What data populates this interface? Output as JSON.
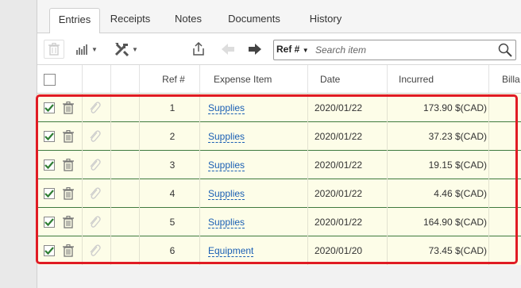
{
  "tabs": [
    {
      "label": "Entries",
      "active": true
    },
    {
      "label": "Receipts",
      "active": false
    },
    {
      "label": "Notes",
      "active": false
    },
    {
      "label": "Documents",
      "active": false
    },
    {
      "label": "History",
      "active": false
    }
  ],
  "toolbar": {
    "icons": [
      "trash-icon",
      "bar-chart-icon",
      "tools-icon",
      "export-icon",
      "arrow-left-icon",
      "arrow-right-icon"
    ]
  },
  "search": {
    "field_selector": "Ref #",
    "placeholder": "Search item"
  },
  "table": {
    "columns": [
      "Ref #",
      "Expense Item",
      "Date",
      "Incurred",
      "Billa"
    ],
    "rows": [
      {
        "ref": "1",
        "item": "Supplies",
        "date": "2020/01/22",
        "incurred": "173.90 $(CAD)",
        "checked": true
      },
      {
        "ref": "2",
        "item": "Supplies",
        "date": "2020/01/22",
        "incurred": "37.23 $(CAD)",
        "checked": true
      },
      {
        "ref": "3",
        "item": "Supplies",
        "date": "2020/01/22",
        "incurred": "19.15 $(CAD)",
        "checked": true
      },
      {
        "ref": "4",
        "item": "Supplies",
        "date": "2020/01/22",
        "incurred": "4.46 $(CAD)",
        "checked": true
      },
      {
        "ref": "5",
        "item": "Supplies",
        "date": "2020/01/22",
        "incurred": "164.90 $(CAD)",
        "checked": true
      },
      {
        "ref": "6",
        "item": "Equipment",
        "date": "2020/01/20",
        "incurred": "73.45 $(CAD)",
        "checked": true
      }
    ]
  },
  "colors": {
    "row_bg": "#fdfde8",
    "row_border": "#3e7a3e",
    "check": "#2e7d32",
    "link": "#1a5fb4",
    "highlight": "#e01b24"
  }
}
